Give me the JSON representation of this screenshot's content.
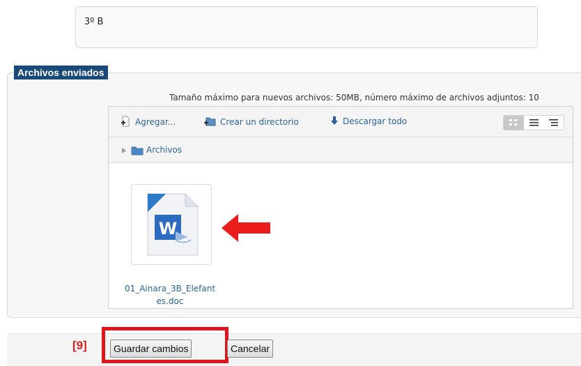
{
  "text_area": {
    "value": "3º B"
  },
  "section": {
    "legend": "Archivos enviados"
  },
  "max_info": "Tamaño máximo para nuevos archivos: 50MB, número máximo de archivos adjuntos: 10",
  "toolbar": {
    "add_label": "Agregar...",
    "mkdir_label": "Crear un directorio",
    "download_label": "Descargar todo"
  },
  "path": {
    "folder": "Archivos"
  },
  "file": {
    "name_line1": "01_Ainara_3B_Elefant",
    "name_line2": "es.doc",
    "icon": "word-doc-icon"
  },
  "annotation": {
    "step": "[9]"
  },
  "buttons": {
    "save": "Guardar cambios",
    "cancel": "Cancelar"
  },
  "colors": {
    "legend_bg": "#1a4a7a",
    "highlight": "#e0141c",
    "link": "#2a6496"
  }
}
